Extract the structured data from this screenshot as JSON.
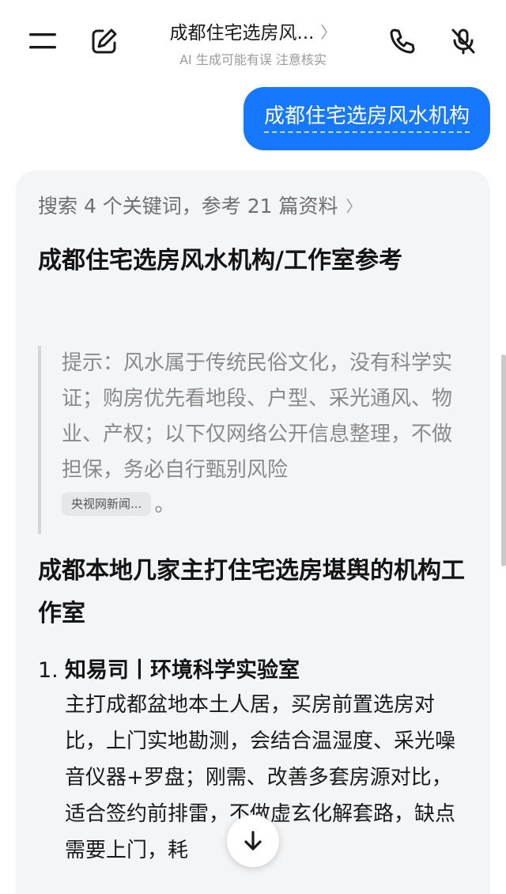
{
  "header": {
    "title": "成都住宅选房风...",
    "subtitle": "AI 生成可能有误 注意核实",
    "icons": {
      "menu": "menu-icon",
      "edit": "edit-icon",
      "title_chevron": "chevron-right-icon",
      "phone": "phone-icon",
      "mute": "mute-icon"
    }
  },
  "user_message": {
    "text": "成都住宅选房风水机构"
  },
  "answer": {
    "search_summary": "搜索 4 个关键词，参考 21 篇资料",
    "heading1": "成都住宅选房风水机构/工作室参考",
    "tip": "提示：风水属于传统民俗文化，没有科学实证；购房优先看地段、户型、采光通风、物业、产权；以下仅网络公开信息整理，不做担保，务必自行甄别风险",
    "source_chip": "央视网新闻...",
    "tip_end": "。",
    "heading2": "成都本地几家主打住宅选房堪舆的机构工作室",
    "items": [
      {
        "number": "1.",
        "title": "知易司丨环境科学实验室",
        "body": "主打成都盆地本土人居，买房前置选房对比，上门实地勘测，会结合温湿度、采光噪音仪器+罗盘；刚需、改善多套房源对比，适合签约前排雷，不做虚玄化解套路，缺点需要上门，耗"
      }
    ]
  },
  "colors": {
    "accent": "#1677ff",
    "card_bg": "#f4f5f7",
    "muted_text": "#8a8a8a"
  }
}
